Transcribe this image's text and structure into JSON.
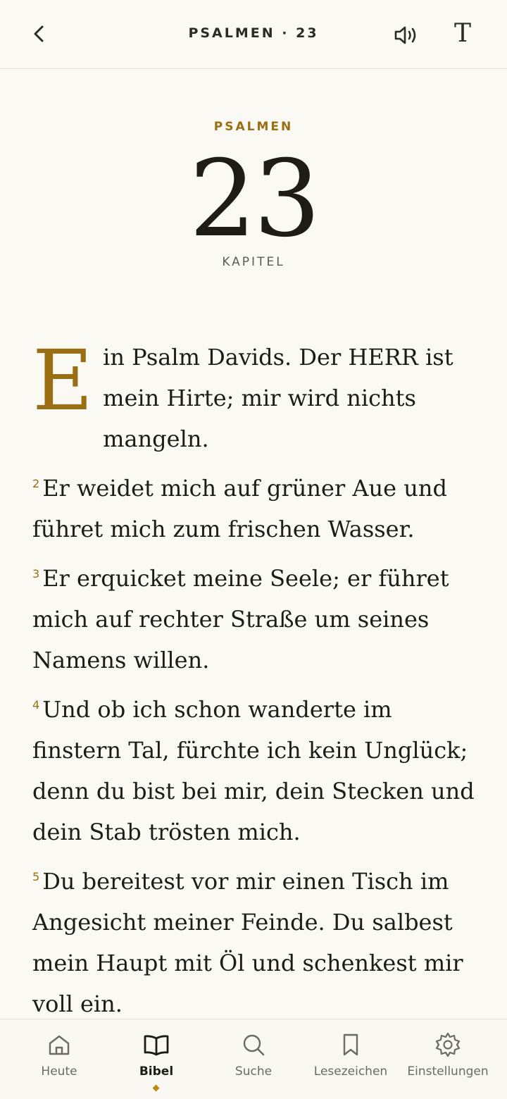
{
  "header": {
    "title": "PSALMEN · 23",
    "back_icon": "chevron-left-icon",
    "audio_icon": "speaker-icon",
    "font_icon_glyph": "T"
  },
  "chapter": {
    "book": "PSALMEN",
    "number": "23",
    "label": "KAPITEL"
  },
  "verses": [
    {
      "num": "",
      "dropcap": "E",
      "text": "in Psalm Davids. Der HERR ist mein Hirte; mir wird nichts mangeln."
    },
    {
      "num": "2",
      "text": "Er weidet mich auf grüner Aue und führet mich zum frischen Wasser."
    },
    {
      "num": "3",
      "text": "Er erquicket meine Seele; er führet mich auf rechter Straße um seines Namens willen."
    },
    {
      "num": "4",
      "text": "Und ob ich schon wanderte im finstern Tal, fürchte ich kein Unglück; denn du bist bei mir, dein Stecken und dein Stab trösten mich."
    },
    {
      "num": "5",
      "text": "Du bereitest vor mir einen Tisch im Angesicht meiner Feinde. Du salbest mein Haupt mit Öl und schenkest mir voll ein."
    }
  ],
  "tabs": [
    {
      "label": "Heute",
      "icon": "home-icon"
    },
    {
      "label": "Bibel",
      "icon": "book-icon",
      "active": true
    },
    {
      "label": "Suche",
      "icon": "search-icon"
    },
    {
      "label": "Lesezeichen",
      "icon": "bookmark-icon"
    },
    {
      "label": "Einstellungen",
      "icon": "gear-icon"
    }
  ],
  "colors": {
    "background": "#fbf9f4",
    "accent": "#9a6e12",
    "text": "#1f1c18"
  }
}
